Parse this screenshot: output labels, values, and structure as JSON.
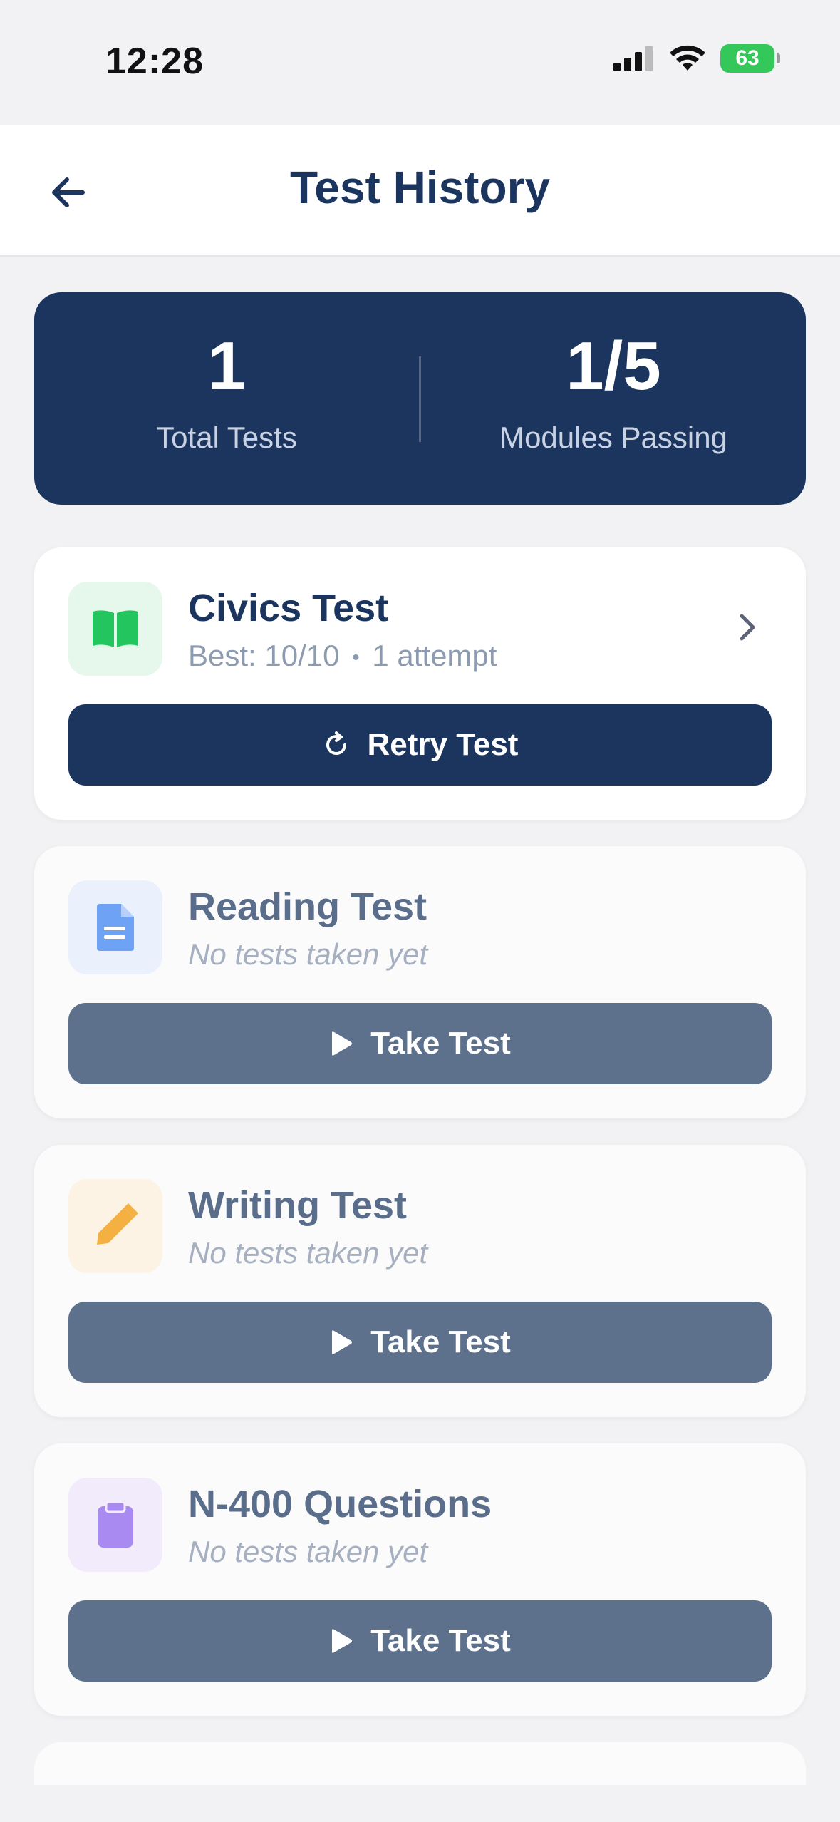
{
  "status_bar": {
    "time": "12:28",
    "battery": "63",
    "signal_icon": "cellular-signal-icon",
    "wifi_icon": "wifi-icon"
  },
  "header": {
    "title": "Test History",
    "back_icon": "arrow-left-icon"
  },
  "summary": {
    "total_tests_value": "1",
    "total_tests_label": "Total Tests",
    "modules_passing_value": "1/5",
    "modules_passing_label": "Modules Passing"
  },
  "cards": [
    {
      "title": "Civics Test",
      "best": "Best: 10/10",
      "separator": "•",
      "attempts": "1 attempt",
      "button_label": "Retry Test",
      "icon": "book-icon",
      "icon_color": "#22c55e",
      "icon_bg": "#e6f7ec"
    },
    {
      "title": "Reading Test",
      "subtitle": "No tests taken yet",
      "button_label": "Take Test",
      "icon": "document-icon",
      "icon_color": "#6ea2f5",
      "icon_bg": "#ebf1fc"
    },
    {
      "title": "Writing Test",
      "subtitle": "No tests taken yet",
      "button_label": "Take Test",
      "icon": "pencil-icon",
      "icon_color": "#f5b042",
      "icon_bg": "#fdf3e5"
    },
    {
      "title": "N-400 Questions",
      "subtitle": "No tests taken yet",
      "button_label": "Take Test",
      "icon": "clipboard-icon",
      "icon_color": "#a98af0",
      "icon_bg": "#f1ebfc"
    }
  ],
  "colors": {
    "primary": "#1c355e",
    "secondary_button": "#5d708c",
    "background": "#f2f2f4"
  }
}
